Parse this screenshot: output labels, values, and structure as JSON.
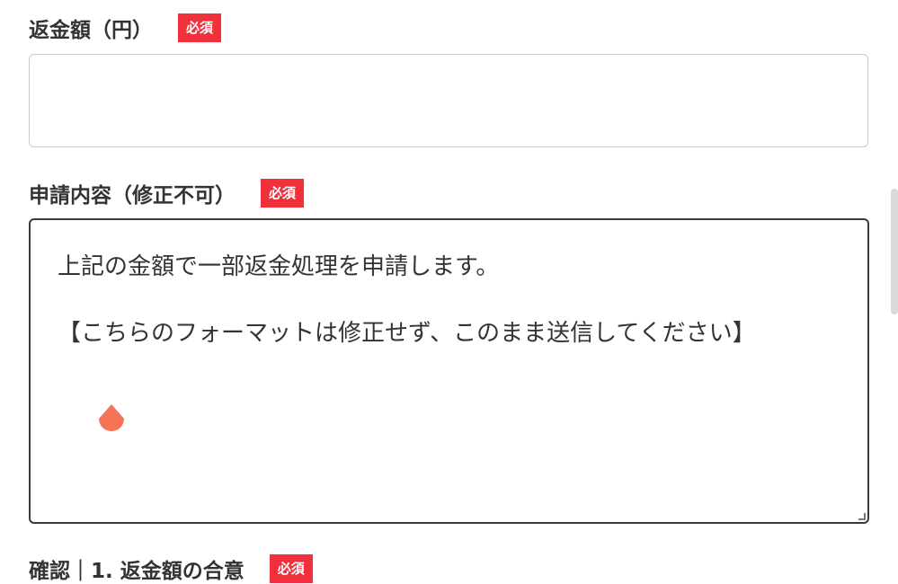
{
  "colors": {
    "badge_bg": "#f0303b",
    "text": "#333333",
    "input_border": "#c9c9c9",
    "textarea_border": "#3a3a3a",
    "cursor_handle": "#f57356"
  },
  "refund_amount": {
    "label": "返金額（円）",
    "required_badge": "必須",
    "value": "",
    "placeholder": ""
  },
  "request_content": {
    "label": "申請内容（修正不可）",
    "required_badge": "必須",
    "line1": "上記の金額で一部返金処理を申請します。",
    "line2": "【こちらのフォーマットは修正せず、このまま送信してください】"
  },
  "confirm": {
    "label": "確認｜1. 返金額の合意",
    "required_badge": "必須"
  }
}
